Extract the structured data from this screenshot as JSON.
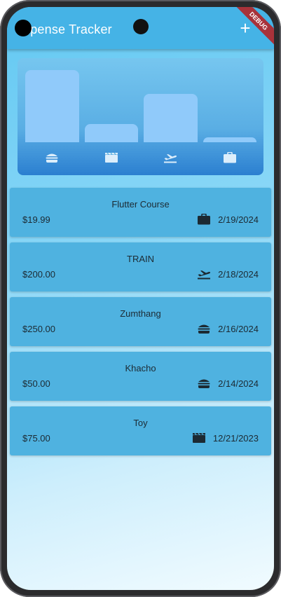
{
  "app": {
    "title": "xpense Tracker",
    "add_label": "+",
    "debug_banner": "DEBUG"
  },
  "chart_data": {
    "type": "bar",
    "categories": [
      "food",
      "leisure",
      "travel",
      "work"
    ],
    "category_icons": [
      "burger-icon",
      "movie-icon",
      "flight-takeoff-icon",
      "briefcase-icon"
    ],
    "values": [
      0.94,
      0.24,
      0.63,
      0.06
    ],
    "value_scale": "relative fraction of the largest category"
  },
  "expenses": [
    {
      "title": "Flutter Course",
      "amount": "$19.99",
      "icon": "briefcase-icon",
      "date": "2/19/2024"
    },
    {
      "title": "TRAIN",
      "amount": "$200.00",
      "icon": "flight-takeoff-icon",
      "date": "2/18/2024"
    },
    {
      "title": "Zumthang",
      "amount": "$250.00",
      "icon": "burger-icon",
      "date": "2/16/2024"
    },
    {
      "title": "Khacho",
      "amount": "$50.00",
      "icon": "burger-icon",
      "date": "2/14/2024"
    },
    {
      "title": "Toy",
      "amount": "$75.00",
      "icon": "movie-icon",
      "date": "12/21/2023"
    }
  ],
  "colors": {
    "appbar": "#45b3e6",
    "card": "#4fb2e0",
    "bar": "#90cafa",
    "icon_dark": "#1c2a33",
    "icon_light": "#dceefb"
  }
}
